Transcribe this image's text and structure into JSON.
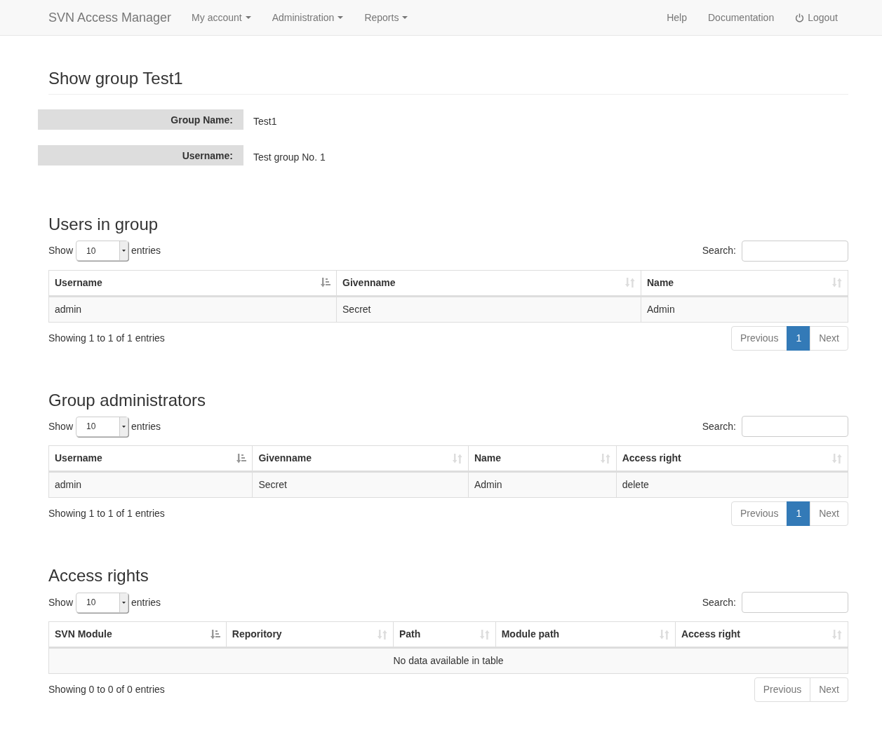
{
  "navbar": {
    "brand": "SVN Access Manager",
    "menus": [
      {
        "label": "My account"
      },
      {
        "label": "Administration"
      },
      {
        "label": "Reports"
      }
    ],
    "right_links": [
      {
        "label": "Help",
        "kind": "text"
      },
      {
        "label": "Documentation",
        "kind": "text"
      },
      {
        "label": "Logout",
        "kind": "logout"
      }
    ]
  },
  "page_title": "Show group Test1",
  "details": [
    {
      "label": "Group Name:",
      "value": "Test1"
    },
    {
      "label": "Username:",
      "value": "Test group No. 1"
    }
  ],
  "sections": [
    {
      "title": "Users in group",
      "show_label": "Show",
      "page_size": "10",
      "entries_label": "entries",
      "search_label": "Search:",
      "columns": [
        {
          "label": "Username",
          "sorted": true
        },
        {
          "label": "Givenname",
          "sorted": false
        },
        {
          "label": "Name",
          "sorted": false
        }
      ],
      "rows": [
        [
          "admin",
          "Secret",
          "Admin"
        ]
      ],
      "info": "Showing 1 to 1 of 1 entries",
      "pagination": {
        "previous": {
          "label": "Previous",
          "disabled": true
        },
        "pages": [
          {
            "label": "1",
            "selected": true
          }
        ],
        "next": {
          "label": "Next",
          "disabled": true
        }
      }
    },
    {
      "title": "Group administrators",
      "show_label": "Show",
      "page_size": "10",
      "entries_label": "entries",
      "search_label": "Search:",
      "columns": [
        {
          "label": "Username",
          "sorted": true
        },
        {
          "label": "Givenname",
          "sorted": false
        },
        {
          "label": "Name",
          "sorted": false
        },
        {
          "label": "Access right",
          "sorted": false
        }
      ],
      "rows": [
        [
          "admin",
          "Secret",
          "Admin",
          "delete"
        ]
      ],
      "info": "Showing 1 to 1 of 1 entries",
      "pagination": {
        "previous": {
          "label": "Previous",
          "disabled": true
        },
        "pages": [
          {
            "label": "1",
            "selected": true
          }
        ],
        "next": {
          "label": "Next",
          "disabled": true
        }
      }
    },
    {
      "title": "Access rights",
      "show_label": "Show",
      "page_size": "10",
      "entries_label": "entries",
      "search_label": "Search:",
      "columns": [
        {
          "label": "SVN Module",
          "sorted": true
        },
        {
          "label": "Reporitory",
          "sorted": false
        },
        {
          "label": "Path",
          "sorted": false
        },
        {
          "label": "Module path",
          "sorted": false
        },
        {
          "label": "Access right",
          "sorted": false
        }
      ],
      "empty_text": "No data available in table",
      "info": "Showing 0 to 0 of 0 entries",
      "pagination": {
        "previous": {
          "label": "Previous",
          "disabled": true
        },
        "next": {
          "label": "Next",
          "disabled": true
        }
      }
    }
  ]
}
